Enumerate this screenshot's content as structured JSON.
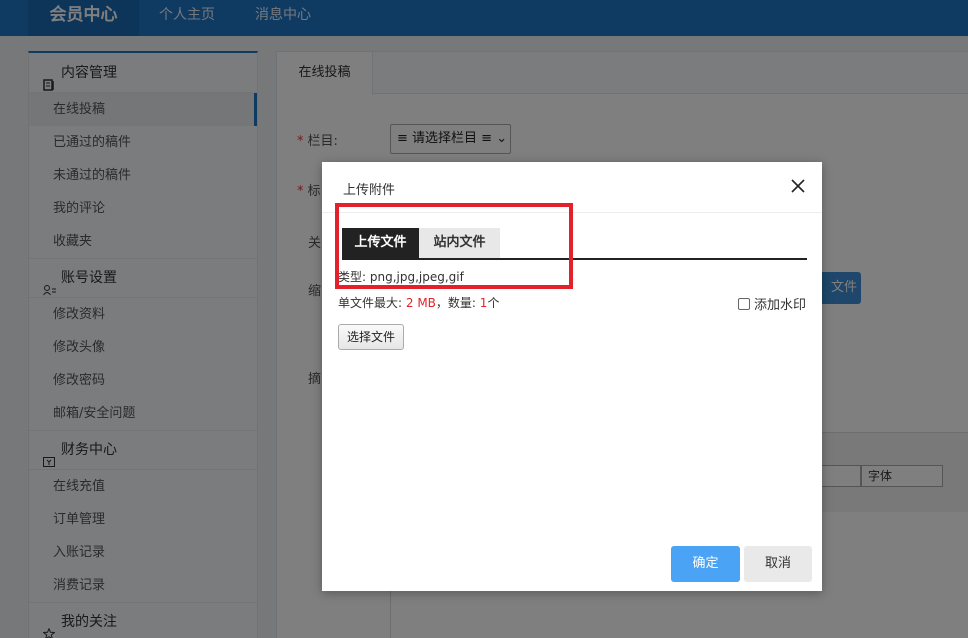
{
  "topbar": {
    "brand": "会员中心",
    "nav": [
      "个人主页",
      "消息中心"
    ]
  },
  "sidebar": {
    "groups": [
      {
        "label": "内容管理",
        "icon": "document-icon",
        "items": [
          "在线投稿",
          "已通过的稿件",
          "未通过的稿件",
          "我的评论",
          "收藏夹"
        ]
      },
      {
        "label": "账号设置",
        "icon": "user-settings-icon",
        "items": [
          "修改资料",
          "修改头像",
          "修改密码",
          "邮箱/安全问题"
        ]
      },
      {
        "label": "财务中心",
        "icon": "wallet-icon",
        "items": [
          "在线充值",
          "订单管理",
          "入账记录",
          "消费记录"
        ]
      },
      {
        "label": "我的关注",
        "icon": "star-icon",
        "items": []
      }
    ],
    "active_item": "在线投稿"
  },
  "main": {
    "tab": "在线投稿",
    "fields": {
      "column_label": "栏目:",
      "title_label": "标",
      "keywords_label": "关",
      "thumb_label": "缩",
      "summary_label": "摘"
    },
    "column_select": "≡ 请选择栏目 ≡",
    "upload_button_partial": "文件",
    "font_select": "字体"
  },
  "dialog": {
    "title": "上传附件",
    "tabs": [
      "上传文件",
      "站内文件"
    ],
    "active_tab": "上传文件",
    "type_line": "类型: png,jpg,jpeg,gif",
    "limit_prefix": "单文件最大:",
    "limit_size": "2 MB",
    "limit_sep": "，数量:",
    "limit_count": "1",
    "limit_suffix": "个",
    "watermark_label": "添加水印",
    "choose_button": "选择文件",
    "ok_button": "确定",
    "cancel_button": "取消"
  },
  "colors": {
    "topbar": "#1e77c7",
    "ok_button": "#4aa3f5",
    "highlight": "#e3212a"
  }
}
